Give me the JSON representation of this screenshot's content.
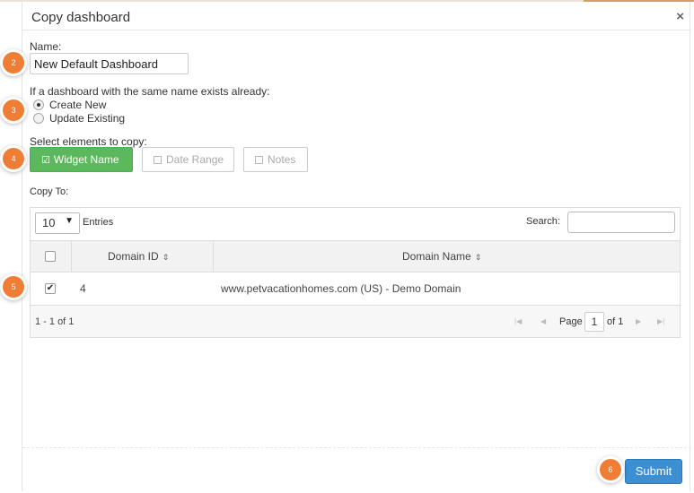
{
  "dialog": {
    "title": "Copy dashboard",
    "close_glyph": "×"
  },
  "name_section": {
    "label": "Name:",
    "value": "New Default Dashboard"
  },
  "duplicate_section": {
    "label": "If a dashboard with the same name exists already:",
    "options": [
      {
        "label": "Create New",
        "selected": true
      },
      {
        "label": "Update Existing",
        "selected": false
      }
    ]
  },
  "elements_section": {
    "label": "Select elements to copy:",
    "buttons": [
      {
        "label": "Widget Name",
        "active": true
      },
      {
        "label": "Date Range",
        "active": false
      },
      {
        "label": "Notes",
        "active": false
      }
    ]
  },
  "copy_to": {
    "label": "Copy To:",
    "page_size": "10",
    "entries_label": "Entries",
    "search_label": "Search:",
    "search_value": "",
    "columns": [
      {
        "label": "Domain ID"
      },
      {
        "label": "Domain Name"
      }
    ],
    "rows": [
      {
        "checked": true,
        "domain_id": "4",
        "domain_name": "www.petvacationhomes.com (US) - Demo Domain"
      }
    ],
    "range_text": "1 - 1 of 1",
    "pager": {
      "page_label": "Page",
      "page_value": "1",
      "of_label": "of 1"
    }
  },
  "submit_label": "Submit",
  "steps": [
    "2",
    "3",
    "4",
    "5",
    "6"
  ],
  "colors": {
    "step_badge": "#ef7d35",
    "active_toggle": "#5cb85c",
    "submit": "#3b8fd2"
  }
}
